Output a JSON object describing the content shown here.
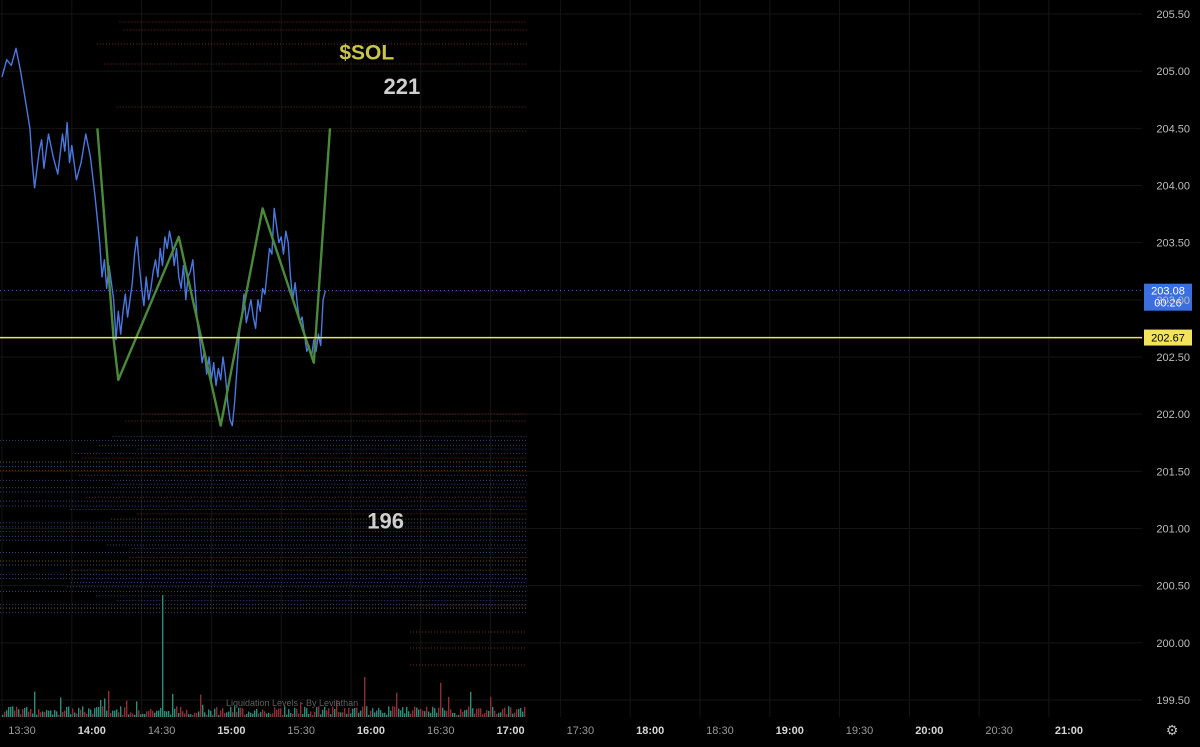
{
  "chart_data": {
    "type": "line",
    "title": "",
    "xlabel": "",
    "ylabel": "",
    "ylim": [
      199.35,
      205.65
    ],
    "x_ticks": [
      {
        "label": "13:30",
        "t": 0,
        "major": false
      },
      {
        "label": "14:00",
        "t": 30,
        "major": true
      },
      {
        "label": "14:30",
        "t": 60,
        "major": false
      },
      {
        "label": "15:00",
        "t": 90,
        "major": true
      },
      {
        "label": "15:30",
        "t": 120,
        "major": false
      },
      {
        "label": "16:00",
        "t": 150,
        "major": true
      },
      {
        "label": "16:30",
        "t": 180,
        "major": false
      },
      {
        "label": "17:00",
        "t": 210,
        "major": true
      },
      {
        "label": "17:30",
        "t": 240,
        "major": false
      },
      {
        "label": "18:00",
        "t": 270,
        "major": true
      },
      {
        "label": "18:30",
        "t": 300,
        "major": false
      },
      {
        "label": "19:00",
        "t": 330,
        "major": true
      },
      {
        "label": "19:30",
        "t": 360,
        "major": false
      },
      {
        "label": "20:00",
        "t": 390,
        "major": true
      },
      {
        "label": "20:30",
        "t": 420,
        "major": false
      },
      {
        "label": "21:00",
        "t": 450,
        "major": true
      }
    ],
    "y_ticks": [
      {
        "label": "205.50",
        "value": 205.5
      },
      {
        "label": "205.00",
        "value": 205.0
      },
      {
        "label": "204.50",
        "value": 204.5
      },
      {
        "label": "204.00",
        "value": 204.0
      },
      {
        "label": "203.50",
        "value": 203.5
      },
      {
        "label": "203.00",
        "value": 203.0
      },
      {
        "label": "202.50",
        "value": 202.5
      },
      {
        "label": "202.00",
        "value": 202.0
      },
      {
        "label": "201.50",
        "value": 201.5
      },
      {
        "label": "201.00",
        "value": 201.0
      },
      {
        "label": "200.50",
        "value": 200.5
      },
      {
        "label": "200.00",
        "value": 200.0
      },
      {
        "label": "199.50",
        "value": 199.5
      }
    ],
    "series": [
      {
        "color": "#4a78e0",
        "points": [
          [
            0,
            204.95
          ],
          [
            2,
            205.1
          ],
          [
            4,
            205.05
          ],
          [
            6,
            205.2
          ],
          [
            8,
            205.0
          ],
          [
            10,
            204.75
          ],
          [
            12,
            204.5
          ],
          [
            13,
            204.2
          ],
          [
            14,
            203.98
          ],
          [
            16,
            204.3
          ],
          [
            17,
            204.4
          ],
          [
            18,
            204.15
          ],
          [
            20,
            204.45
          ],
          [
            22,
            204.25
          ],
          [
            24,
            204.1
          ],
          [
            26,
            204.45
          ],
          [
            27,
            204.3
          ],
          [
            28,
            204.55
          ],
          [
            29,
            204.2
          ],
          [
            30,
            204.35
          ],
          [
            32,
            204.05
          ],
          [
            34,
            204.2
          ],
          [
            36,
            204.45
          ],
          [
            38,
            204.25
          ],
          [
            40,
            203.9
          ],
          [
            42,
            203.5
          ],
          [
            43,
            203.2
          ],
          [
            44,
            203.35
          ],
          [
            45,
            203.1
          ],
          [
            46,
            203.3
          ],
          [
            48,
            203.0
          ],
          [
            49,
            202.65
          ],
          [
            50,
            202.9
          ],
          [
            51,
            202.7
          ],
          [
            52,
            202.9
          ],
          [
            53,
            203.05
          ],
          [
            54,
            202.85
          ],
          [
            55,
            203.0
          ],
          [
            56,
            203.15
          ],
          [
            57,
            203.4
          ],
          [
            58,
            203.55
          ],
          [
            59,
            203.3
          ],
          [
            60,
            203.1
          ],
          [
            61,
            202.95
          ],
          [
            62,
            203.2
          ],
          [
            63,
            203.0
          ],
          [
            64,
            203.1
          ],
          [
            65,
            203.25
          ],
          [
            66,
            203.35
          ],
          [
            67,
            203.2
          ],
          [
            68,
            203.45
          ],
          [
            69,
            203.3
          ],
          [
            70,
            203.55
          ],
          [
            71,
            203.45
          ],
          [
            72,
            203.6
          ],
          [
            73,
            203.5
          ],
          [
            74,
            203.3
          ],
          [
            75,
            203.45
          ],
          [
            76,
            203.2
          ],
          [
            77,
            203.1
          ],
          [
            78,
            203.3
          ],
          [
            79,
            203.0
          ],
          [
            80,
            203.2
          ],
          [
            81,
            203.25
          ],
          [
            82,
            203.35
          ],
          [
            83,
            203.1
          ],
          [
            84,
            202.8
          ],
          [
            85,
            202.65
          ],
          [
            86,
            202.45
          ],
          [
            87,
            202.55
          ],
          [
            88,
            202.35
          ],
          [
            89,
            202.5
          ],
          [
            90,
            202.3
          ],
          [
            91,
            202.45
          ],
          [
            92,
            202.25
          ],
          [
            93,
            202.4
          ],
          [
            94,
            202.3
          ],
          [
            95,
            202.5
          ],
          [
            96,
            202.35
          ],
          [
            97,
            202.1
          ],
          [
            98,
            201.95
          ],
          [
            99,
            201.9
          ],
          [
            100,
            202.1
          ],
          [
            101,
            202.4
          ],
          [
            102,
            202.7
          ],
          [
            103,
            202.85
          ],
          [
            104,
            203.05
          ],
          [
            105,
            202.8
          ],
          [
            106,
            202.9
          ],
          [
            107,
            203.0
          ],
          [
            108,
            202.85
          ],
          [
            109,
            202.75
          ],
          [
            110,
            203.0
          ],
          [
            111,
            202.9
          ],
          [
            112,
            203.1
          ],
          [
            113,
            203.05
          ],
          [
            114,
            203.25
          ],
          [
            115,
            203.45
          ],
          [
            116,
            203.4
          ],
          [
            117,
            203.8
          ],
          [
            118,
            203.65
          ],
          [
            119,
            203.5
          ],
          [
            120,
            203.55
          ],
          [
            121,
            203.4
          ],
          [
            122,
            203.6
          ],
          [
            123,
            203.5
          ],
          [
            124,
            203.2
          ],
          [
            125,
            203.0
          ],
          [
            126,
            203.15
          ],
          [
            127,
            202.95
          ],
          [
            128,
            202.8
          ],
          [
            129,
            202.85
          ],
          [
            130,
            202.7
          ],
          [
            131,
            202.55
          ],
          [
            132,
            202.6
          ],
          [
            133,
            202.5
          ],
          [
            134,
            202.65
          ],
          [
            135,
            202.55
          ],
          [
            136,
            202.7
          ],
          [
            137,
            202.6
          ],
          [
            138,
            203.0
          ],
          [
            139,
            203.08
          ]
        ]
      },
      {
        "color": "#4a8a3a",
        "points": [
          [
            41,
            204.5
          ],
          [
            48,
            202.65
          ],
          [
            50,
            202.3
          ],
          [
            76,
            203.55
          ],
          [
            94,
            201.9
          ],
          [
            112,
            203.8
          ],
          [
            134,
            202.45
          ],
          [
            141,
            204.5
          ]
        ]
      }
    ],
    "reference_lines": [
      {
        "value": 202.67,
        "color": "#f2e35a",
        "label": "202.67"
      },
      {
        "value": 203.08,
        "color": "#3b6fe0",
        "label": "203.08",
        "sublabel": "00:26"
      }
    ],
    "annotations": [
      {
        "text": "$SOL",
        "t": 145,
        "value": 205.1,
        "color": "#c9c44a"
      },
      {
        "text": "221",
        "t": 164,
        "value": 204.8,
        "color": "#cfcfcf"
      },
      {
        "text": "196",
        "t": 157,
        "value": 201.0,
        "color": "#cfcfcf"
      }
    ],
    "indicator_label": "Liquidation Levels - By Leviathan",
    "grid": true,
    "legend": "none"
  },
  "icons": {
    "settings": "gear-icon"
  }
}
